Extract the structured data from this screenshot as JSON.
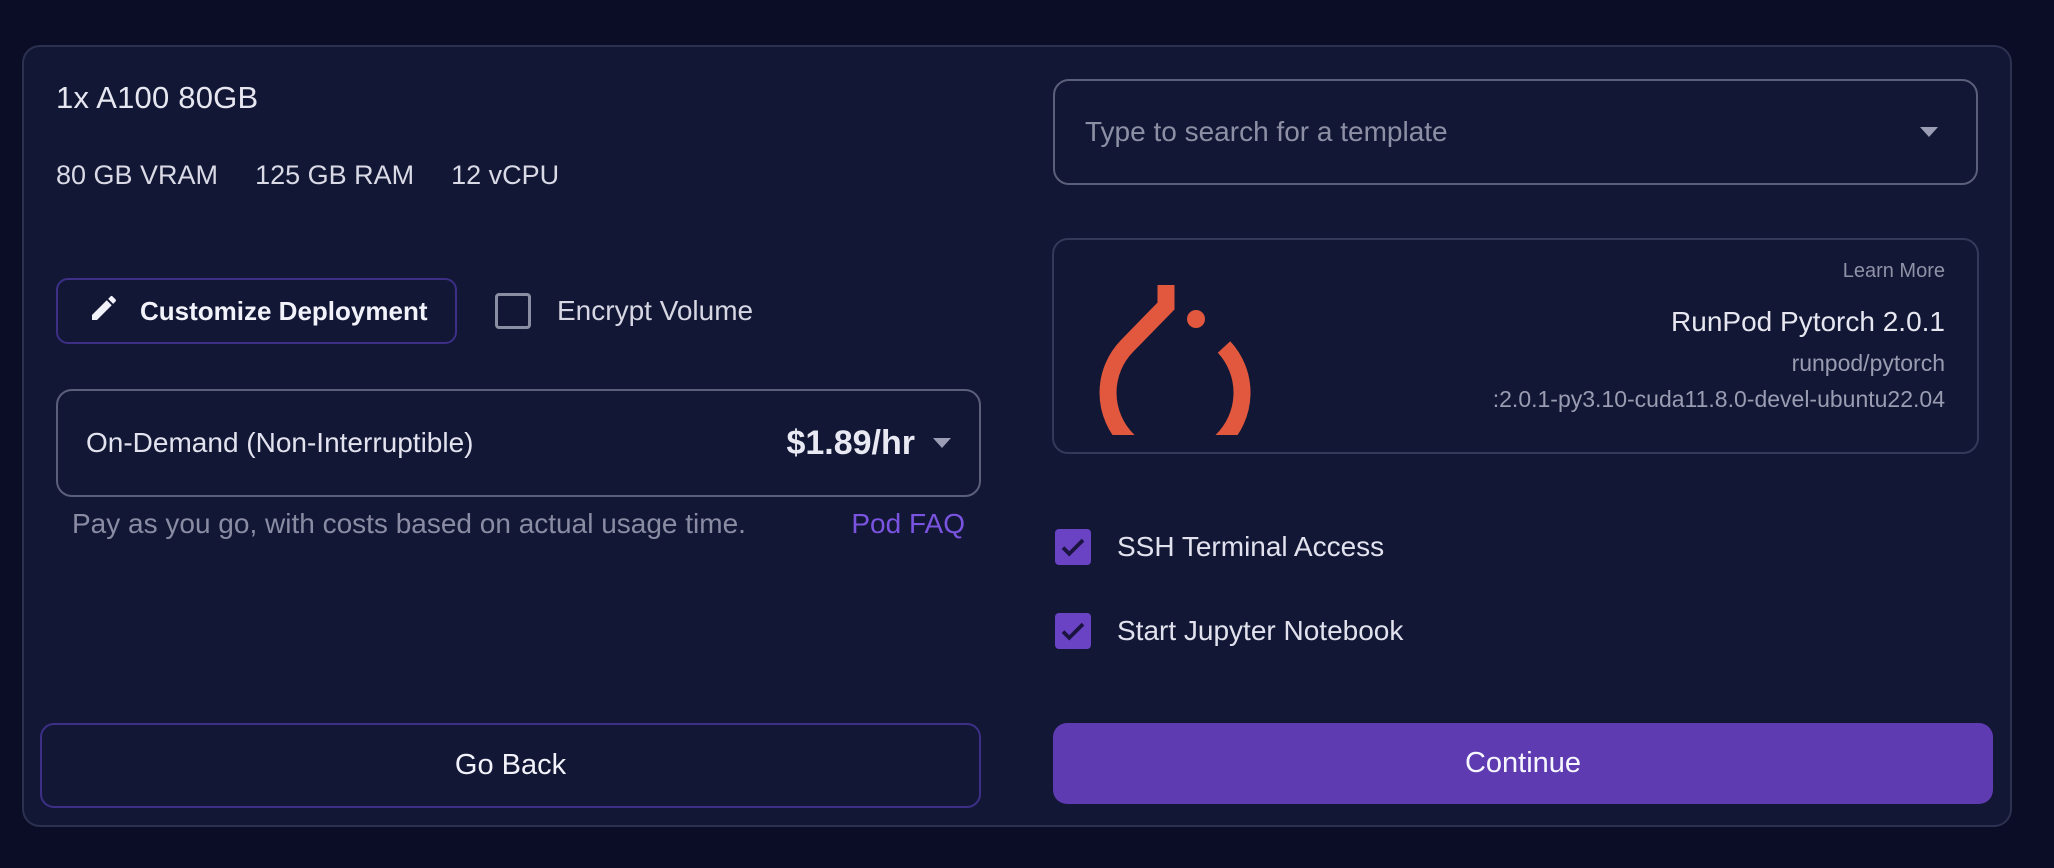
{
  "gpu": {
    "title": "1x A100 80GB",
    "specs": [
      "80 GB VRAM",
      "125 GB RAM",
      "12 vCPU"
    ]
  },
  "customize": {
    "label": "Customize Deployment",
    "icon": "pencil-icon"
  },
  "encrypt": {
    "label": "Encrypt Volume",
    "checked": false
  },
  "pricing": {
    "mode": "On-Demand (Non-Interruptible)",
    "price": "$1.89/hr",
    "description": "Pay as you go, with costs based on actual usage time.",
    "faq_label": "Pod FAQ"
  },
  "template_search": {
    "placeholder": "Type to search for a template",
    "value": ""
  },
  "template": {
    "learn_more": "Learn More",
    "name": "RunPod Pytorch 2.0.1",
    "image_line1": "runpod/pytorch",
    "image_line2": ":2.0.1-py3.10-cuda11.8.0-devel-ubuntu22.04",
    "logo": "pytorch-logo",
    "logo_color": "#e2583e"
  },
  "options": {
    "ssh": {
      "label": "SSH Terminal Access",
      "checked": true
    },
    "jupyter": {
      "label": "Start Jupyter Notebook",
      "checked": true
    }
  },
  "actions": {
    "back_label": "Go Back",
    "continue_label": "Continue"
  },
  "colors": {
    "background": "#0b0d26",
    "panel": "#121735",
    "accent": "#5e3bb0",
    "link": "#7a54e0"
  }
}
